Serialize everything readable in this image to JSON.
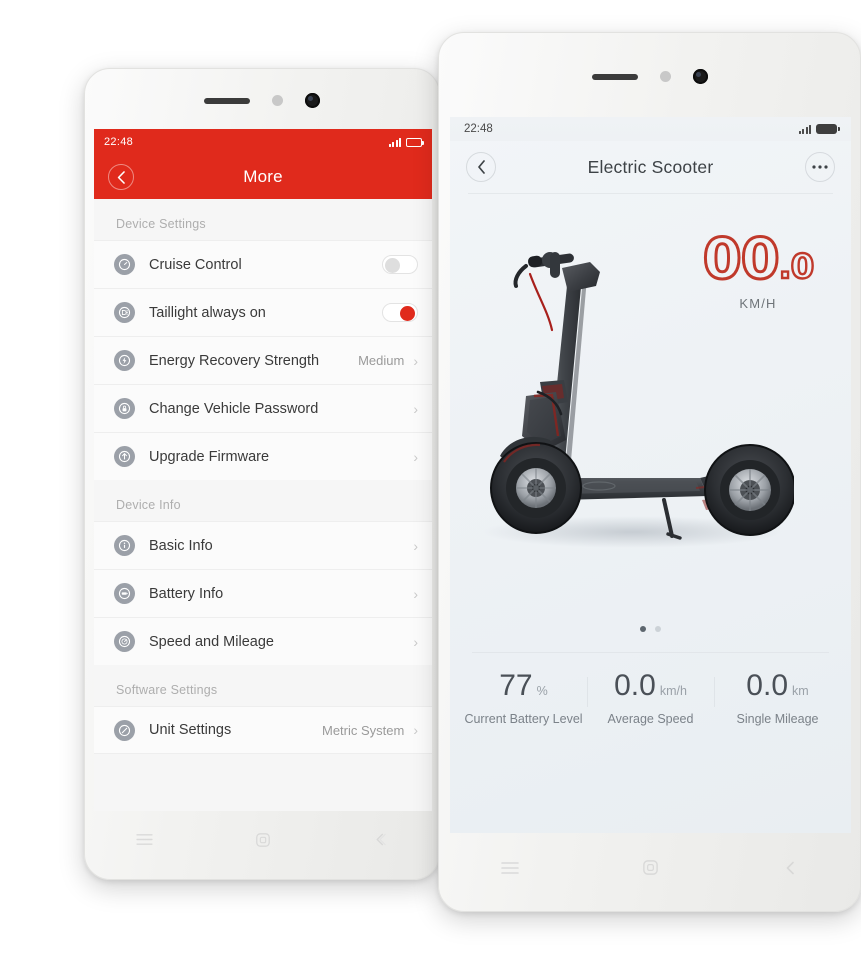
{
  "left_phone": {
    "status_bar": {
      "time": "22:48",
      "signal_icon": "signal-bars-icon",
      "battery_icon": "battery-icon"
    },
    "appbar": {
      "title": "More",
      "back_icon": "chevron-left-icon"
    },
    "sections": [
      {
        "header": "Device Settings",
        "rows": [
          {
            "icon": "cruise-control-icon",
            "label": "Cruise Control",
            "control": "toggle",
            "toggle_on": false
          },
          {
            "icon": "taillight-icon",
            "label": "Taillight always on",
            "control": "toggle",
            "toggle_on": true
          },
          {
            "icon": "energy-bolt-icon",
            "label": "Energy Recovery Strength",
            "control": "value",
            "value": "Medium"
          },
          {
            "icon": "lock-icon",
            "label": "Change Vehicle Password",
            "control": "chevron",
            "value": ""
          },
          {
            "icon": "upgrade-arrow-icon",
            "label": "Upgrade Firmware",
            "control": "chevron",
            "value": ""
          }
        ]
      },
      {
        "header": "Device Info",
        "rows": [
          {
            "icon": "info-icon",
            "label": "Basic Info",
            "control": "chevron",
            "value": ""
          },
          {
            "icon": "battery-info-icon",
            "label": "Battery Info",
            "control": "chevron",
            "value": ""
          },
          {
            "icon": "speedometer-icon",
            "label": "Speed and Mileage",
            "control": "chevron",
            "value": ""
          }
        ]
      },
      {
        "header": "Software Settings",
        "rows": [
          {
            "icon": "unit-settings-icon",
            "label": "Unit Settings",
            "control": "value",
            "value": "Metric System"
          }
        ]
      }
    ],
    "nav_bar": {
      "menu_icon": "menu-icon",
      "home_icon": "home-icon",
      "back_icon": "back-icon"
    }
  },
  "right_phone": {
    "status_bar": {
      "time": "22:48",
      "signal_icon": "signal-bars-icon",
      "battery_icon": "battery-icon"
    },
    "appbar": {
      "title": "Electric Scooter",
      "back_icon": "chevron-left-icon",
      "more_icon": "more-dots-icon"
    },
    "speedometer": {
      "value": "00",
      "decimal": ".0",
      "unit": "KM/H",
      "color": "#c0392b"
    },
    "hero_image": "electric-scooter-illustration",
    "pager": {
      "count": 2,
      "active_index": 0
    },
    "stats": [
      {
        "value": "77",
        "unit": "%",
        "label": "Current Battery Level"
      },
      {
        "value": "0.0",
        "unit": "km/h",
        "label": "Average Speed"
      },
      {
        "value": "0.0",
        "unit": "km",
        "label": "Single Mileage"
      }
    ],
    "nav_bar": {
      "menu_icon": "menu-icon",
      "home_icon": "home-icon",
      "back_icon": "back-icon"
    }
  },
  "colors": {
    "accent_red": "#e02a1c",
    "speed_red": "#c0392b",
    "screen_bg": "#f4f6f8"
  }
}
